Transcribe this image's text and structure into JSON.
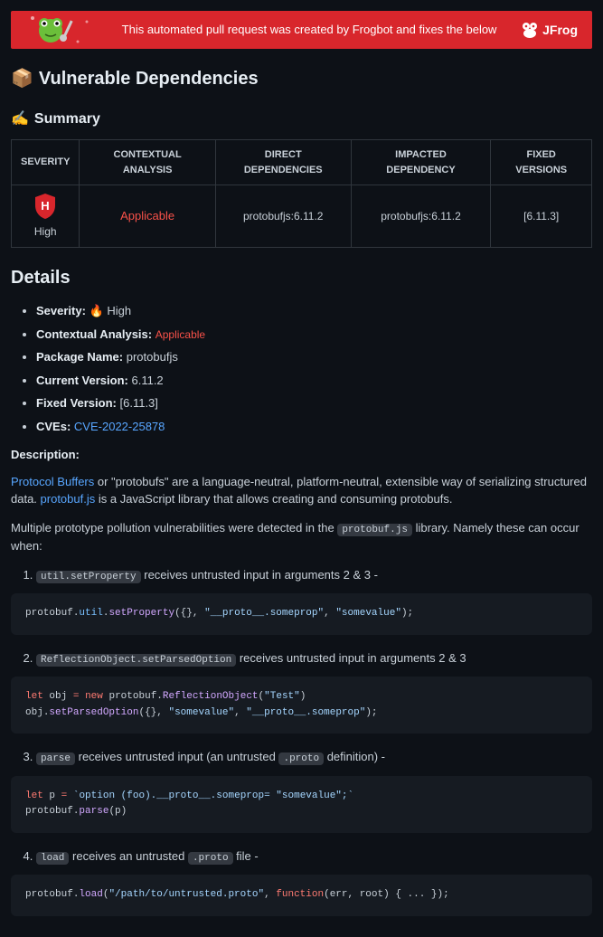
{
  "banner": {
    "text": "This automated pull request was created by Frogbot and fixes the below",
    "logo": "JFrog"
  },
  "headings": {
    "vuln": "Vulnerable Dependencies",
    "summary": "Summary",
    "details": "Details"
  },
  "table": {
    "headers": {
      "severity": "SEVERITY",
      "contextual": "CONTEXTUAL ANALYSIS",
      "direct": "DIRECT DEPENDENCIES",
      "impacted": "IMPACTED DEPENDENCY",
      "fixed": "FIXED VERSIONS"
    },
    "row": {
      "severity": "High",
      "contextual": "Applicable",
      "direct": "protobufjs:6.11.2",
      "impacted": "protobufjs:6.11.2",
      "fixed": "[6.11.3]"
    }
  },
  "details": {
    "severity_label": "Severity:",
    "severity_value": "🔥 High",
    "contextual_label": "Contextual Analysis:",
    "contextual_value": "Applicable",
    "package_label": "Package Name:",
    "package_value": "protobufjs",
    "current_label": "Current Version:",
    "current_value": "6.11.2",
    "fixed_label": "Fixed Version:",
    "fixed_value": "[6.11.3]",
    "cves_label": "CVEs:",
    "cves_value": "CVE-2022-25878"
  },
  "description": {
    "label": "Description:",
    "p1_link": "Protocol Buffers",
    "p1_rest": " or \"protobufs\" are a language-neutral, platform-neutral, extensible way of serializing structured data. ",
    "p1_link2": "protobuf.js",
    "p1_rest2": " is a JavaScript library that allows creating and consuming protobufs.",
    "p2_pre": "Multiple prototype pollution vulnerabilities were detected in the ",
    "p2_code": "protobuf.js",
    "p2_post": " library. Namely these can occur when:"
  },
  "items": {
    "i1_code": "util.setProperty",
    "i1_rest": " receives untrusted input in arguments 2 & 3 -",
    "i2_code": "ReflectionObject.setParsedOption",
    "i2_rest": " receives untrusted input in arguments 2 & 3",
    "i3_code": "parse",
    "i3_mid": " receives untrusted input (an untrusted ",
    "i3_code2": ".proto",
    "i3_rest": " definition) -",
    "i4_code": "load",
    "i4_mid": " receives an untrusted ",
    "i4_code2": ".proto",
    "i4_rest": " file -"
  },
  "code": {
    "c1": {
      "obj": "protobuf",
      "prop": "util",
      "method": "setProperty",
      "arg1": "{}",
      "arg2": "\"__proto__.someprop\"",
      "arg3": "\"somevalue\""
    },
    "c2": {
      "kw_let": "let",
      "v_obj": "obj",
      "eq": "=",
      "kw_new": "new",
      "ns": "protobuf",
      "cls": "ReflectionObject",
      "arg_a": "\"Test\"",
      "line2_obj": "obj",
      "line2_method": "setParsedOption",
      "line2_a1": "{}",
      "line2_a2": "\"somevalue\"",
      "line2_a3": "\"__proto__.someprop\""
    },
    "c3": {
      "kw_let": "let",
      "v": "p",
      "eq": "=",
      "tmpl": "`option (foo).__proto__.someprop= \"somevalue\";`",
      "ns": "protobuf",
      "method": "parse",
      "arg": "p"
    },
    "c4": {
      "ns": "protobuf",
      "method": "load",
      "arg1": "\"/path/to/untrusted.proto\"",
      "kw_fn": "function",
      "params": "(err, root)",
      "body": "{ ... }"
    }
  }
}
